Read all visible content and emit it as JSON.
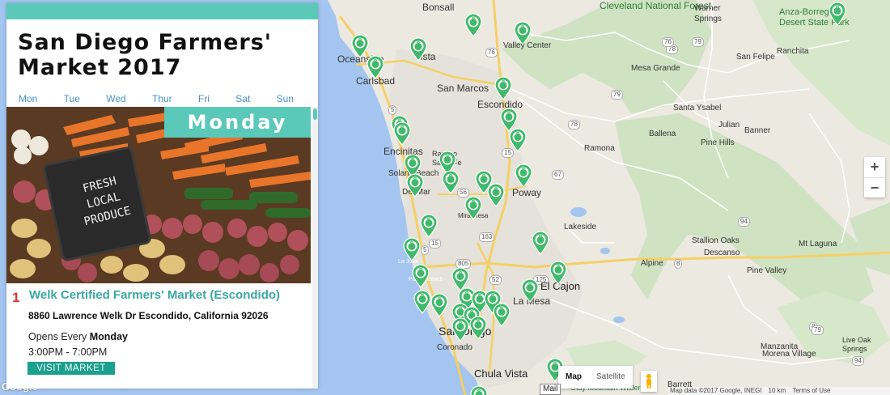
{
  "panel": {
    "title": "San Diego Farmers' Market 2017",
    "days": [
      "Mon",
      "Tue",
      "Wed",
      "Thur",
      "Fri",
      "Sat",
      "Sun"
    ],
    "selected_day": "Monday",
    "photo_sign": [
      "FRESH",
      "LOCAL",
      "PRODUCE"
    ],
    "market": {
      "number": "1",
      "name": "Welk Certified Farmers' Market (Escondido)",
      "address": "8860 Lawrence Welk Dr Escondido, California 92026",
      "opens_prefix": "Opens Every",
      "opens_day": "Monday",
      "hours": "3:00PM - 7:00PM",
      "button": "VISIT MARKET"
    }
  },
  "map": {
    "places": [
      "Bonsall",
      "Cleveland National Forest",
      "Warner Springs",
      "Anza-Borrego Desert State Park",
      "Valley Center",
      "Oceanside",
      "Vista",
      "San Felipe",
      "Ranchita",
      "Mesa Grande",
      "Carlsbad",
      "San Marcos",
      "Escondido",
      "Santa Ysabel",
      "Julian",
      "Banner",
      "Ballena",
      "Pine Hills",
      "Encinitas",
      "Rancho Santa Fe",
      "Ramona",
      "Solana Beach",
      "Del Mar",
      "Poway",
      "Mira Mesa",
      "Lakeside",
      "Stallion Oaks",
      "Mt Laguna",
      "Descanso",
      "La Jolla",
      "Pacific Beach",
      "Alpine",
      "Pine Valley",
      "El Cajon",
      "La Mesa",
      "San Diego",
      "Coronado",
      "Live Oak Springs",
      "Manzanita",
      "Morena Village",
      "Chula Vista",
      "Barrett",
      "Otay Mountain Wilderness"
    ],
    "zoom_in": "+",
    "zoom_out": "−",
    "map_type": [
      "Map",
      "Satellite"
    ],
    "map_tip": "Mail",
    "attribution": [
      "Map data ©2017 Google, INEGI",
      "10 km",
      "Terms of Use"
    ],
    "google": "Google",
    "route_shields": [
      "76",
      "79",
      "78",
      "76",
      "5",
      "15",
      "78",
      "79",
      "67",
      "56",
      "163",
      "805",
      "8",
      "94",
      "125",
      "8",
      "79",
      "94",
      "5",
      "15",
      "52"
    ]
  }
}
